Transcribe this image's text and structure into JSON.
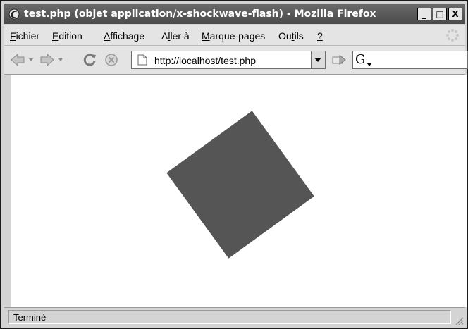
{
  "window": {
    "title": "test.php (objet application/x-shockwave-flash) - Mozilla Firefox",
    "buttons": {
      "minimize": "_",
      "maximize": "□",
      "close": "X"
    }
  },
  "menu": [
    {
      "pre": "",
      "key": "F",
      "post": "ichier"
    },
    {
      "pre": "",
      "key": "E",
      "post": "dition"
    },
    {
      "pre": "",
      "key": "A",
      "post": "ffichage"
    },
    {
      "pre": "A",
      "key": "l",
      "post": "ler à"
    },
    {
      "pre": "",
      "key": "M",
      "post": "arque-pages"
    },
    {
      "pre": "Ou",
      "key": "t",
      "post": "ils"
    },
    {
      "pre": "",
      "key": "?",
      "post": ""
    }
  ],
  "navigation": {
    "back_icon": "back-arrow-icon",
    "forward_icon": "forward-arrow-icon",
    "reload_icon": "reload-icon",
    "stop_icon": "stop-icon",
    "url": "http://localhost/test.php",
    "go_icon": "go-icon",
    "search_engine_label": "G"
  },
  "content": {
    "flash_shape": {
      "shape": "square",
      "color": "#555555",
      "rotation_deg": -36
    }
  },
  "status": {
    "text": "Terminé"
  }
}
